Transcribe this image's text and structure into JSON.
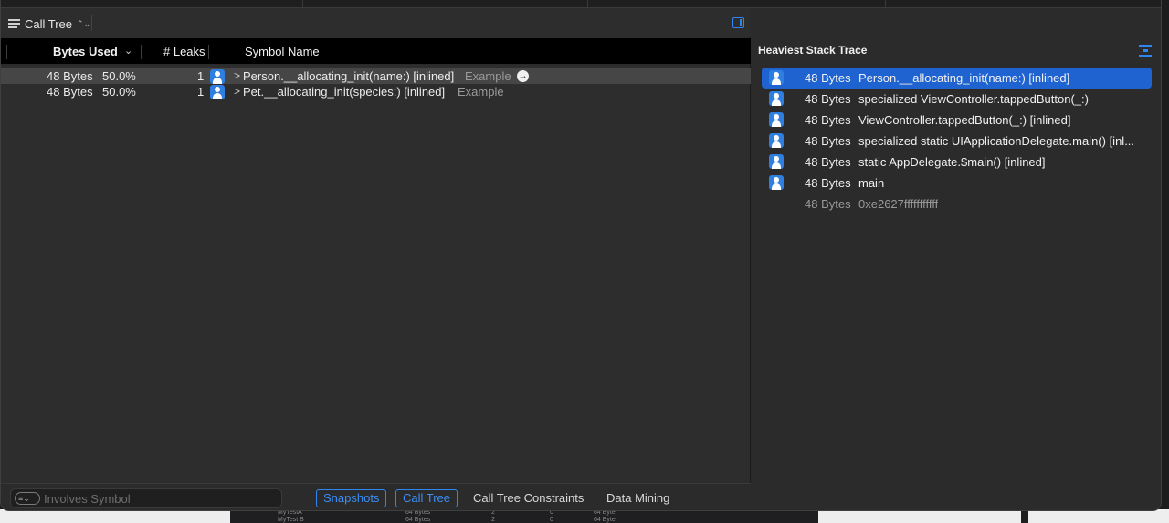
{
  "toolbar": {
    "view_menu_label": "Call Tree",
    "updown_glyph": "⌃⌄"
  },
  "columns": {
    "bytes_used": "Bytes Used",
    "sort_chevron": "⌄",
    "leaks": "# Leaks",
    "symbol_name": "Symbol Name"
  },
  "rows": [
    {
      "bytes": "48 Bytes",
      "percent": "50.0%",
      "leaks": "1",
      "disclosure": ">",
      "symbol": "Person.__allocating_init(name:) [inlined]",
      "library": "Example",
      "go_glyph": "→"
    },
    {
      "bytes": "48 Bytes",
      "percent": "50.0%",
      "leaks": "1",
      "disclosure": ">",
      "symbol": "Pet.__allocating_init(species:) [inlined]",
      "library": "Example"
    }
  ],
  "bottom": {
    "filter_placeholder": "Involves Symbol",
    "filter_icon": "filter-menu-icon",
    "segments": [
      "Snapshots",
      "Call Tree",
      "Call Tree Constraints",
      "Data Mining"
    ]
  },
  "stack_trace": {
    "title": "Heaviest Stack Trace",
    "frames": [
      {
        "bytes": "48 Bytes",
        "symbol": "Person.__allocating_init(name:) [inlined]"
      },
      {
        "bytes": "48 Bytes",
        "symbol": "specialized ViewController.tappedButton(_:)"
      },
      {
        "bytes": "48 Bytes",
        "symbol": "ViewController.tappedButton(_:) [inlined]"
      },
      {
        "bytes": "48 Bytes",
        "symbol": "specialized static UIApplicationDelegate.main() [inl..."
      },
      {
        "bytes": "48 Bytes",
        "symbol": "static AppDelegate.$main() [inlined]"
      },
      {
        "bytes": "48 Bytes",
        "symbol": "main"
      },
      {
        "bytes": "48 Bytes",
        "symbol": "0xe2627fffffffffff"
      }
    ]
  },
  "background_peek": {
    "rows": [
      {
        "name": "MyTestA",
        "bytes": "64 Bytes",
        "count": "2",
        "zero": "0",
        "bytes2": "64 Byte"
      },
      {
        "name": "MyTest B",
        "bytes": "64 Bytes",
        "count": "2",
        "zero": "0",
        "bytes2": "64 Byte"
      }
    ]
  },
  "colors": {
    "accent": "#2f86f0",
    "selection": "#1f63d1",
    "row_highlight": "#464646"
  }
}
